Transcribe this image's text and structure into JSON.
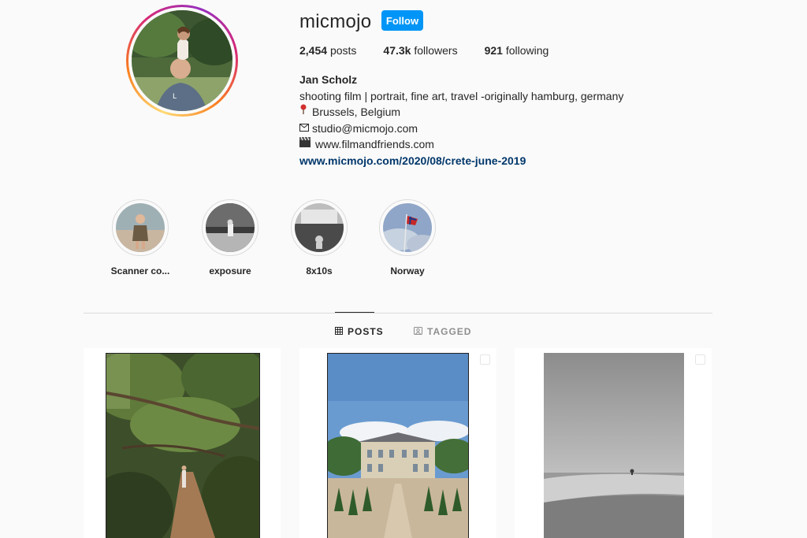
{
  "profile": {
    "username": "micmojo",
    "follow_label": "Follow",
    "stats": {
      "posts_count": "2,454",
      "posts_label": "posts",
      "followers_count": "47.3k",
      "followers_label": "followers",
      "following_count": "921",
      "following_label": "following"
    },
    "bio": {
      "name": "Jan Scholz",
      "line1": "shooting film | portrait, fine art, travel -originally hamburg, germany",
      "line2_icon": "pin-icon",
      "line2": "Brussels, Belgium",
      "line3_icon": "mail-icon",
      "line3": "studio@micmojo.com",
      "line4_icon": "clapperboard-icon",
      "line4": "www.filmandfriends.com",
      "link": "www.micmojo.com/2020/08/crete-june-2019"
    }
  },
  "highlights": [
    {
      "label": "Scanner co..."
    },
    {
      "label": "exposure"
    },
    {
      "label": "8x10s"
    },
    {
      "label": "Norway"
    }
  ],
  "tabs": [
    {
      "label": "POSTS",
      "icon": "grid-icon",
      "active": true
    },
    {
      "label": "TAGGED",
      "icon": "tag-person-icon",
      "active": false
    }
  ],
  "colors": {
    "follow_button": "#0095f6",
    "link": "#00376b",
    "background": "#fafafa"
  }
}
